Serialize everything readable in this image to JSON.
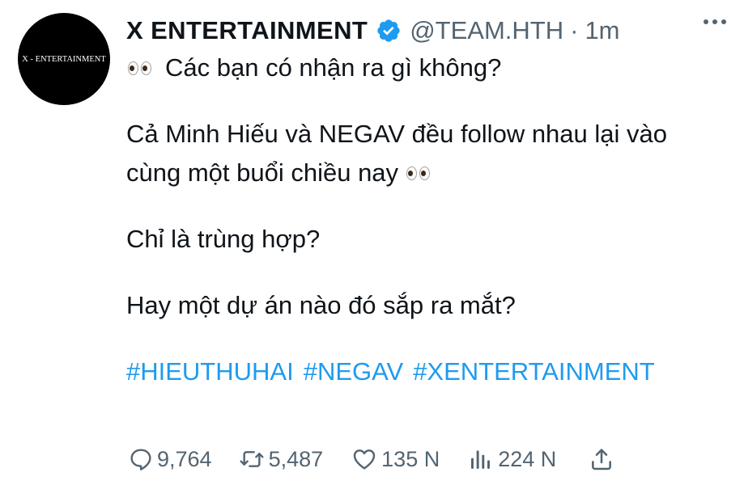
{
  "account": {
    "avatar_text": "X - ENTERTAINMENT",
    "display_name": "X ENTERTAINMENT",
    "verified": true,
    "handle": "@TEAM.HTH",
    "separator": "·",
    "time": "1m"
  },
  "tweet": {
    "line1": "Các bạn có nhận ra gì không?",
    "line2": "Cả Minh Hiếu và NEGAV đều follow nhau lại vào",
    "line3": "cùng một buổi chiều nay",
    "line4": "Chỉ là trùng hợp?",
    "line5": "Hay một dự án nào đó sắp ra mắt?",
    "hashtags": [
      "#HIEUTHUHAI",
      "#NEGAV",
      "#XENTERTAINMENT"
    ],
    "emoji": "eyes"
  },
  "actions": {
    "replies": "9,764",
    "retweets": "5,487",
    "likes": "135 N",
    "views": "224 N"
  },
  "colors": {
    "accent": "#1d9bf0",
    "muted": "#536471",
    "text": "#0f1419",
    "avatar_bg": "#000000"
  },
  "icons": {
    "verified": "verified-badge-icon",
    "more": "more-dots-icon",
    "reply": "reply-icon",
    "retweet": "retweet-icon",
    "like": "heart-icon",
    "views": "views-icon",
    "share": "share-icon",
    "emoji": "eyes-emoji-icon"
  }
}
